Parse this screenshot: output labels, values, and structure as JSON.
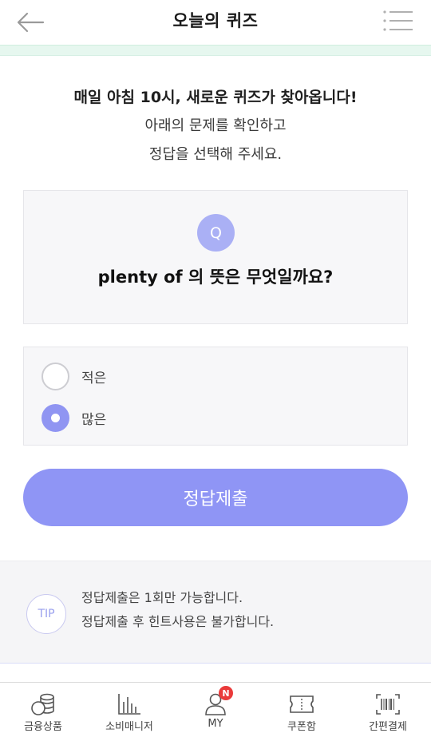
{
  "header": {
    "title": "오늘의 퀴즈",
    "back_icon": "arrow-left-icon",
    "menu_icon": "hamburger-menu-icon"
  },
  "intro": {
    "headline": "매일 아침 10시, 새로운 퀴즈가 찾아옵니다!",
    "line1": "아래의 문제를 확인하고",
    "line2": "정답을 선택해 주세요."
  },
  "question": {
    "badge": "Q",
    "text": "plenty of 의 뜻은 무엇일까요?"
  },
  "options": [
    {
      "label": "적은",
      "selected": false
    },
    {
      "label": "많은",
      "selected": true
    }
  ],
  "submit": {
    "label": "정답제출"
  },
  "tip": {
    "badge": "TIP",
    "line1": "정답제출은 1회만 가능합니다.",
    "line2": "정답제출 후 힌트사용은 불가합니다."
  },
  "bottom_nav": [
    {
      "label": "금융상품",
      "icon": "coins-icon"
    },
    {
      "label": "소비매니저",
      "icon": "bar-chart-icon"
    },
    {
      "label": "MY",
      "icon": "user-icon",
      "badge": "N"
    },
    {
      "label": "쿠폰함",
      "icon": "ticket-icon"
    },
    {
      "label": "간편결제",
      "icon": "barcode-icon"
    }
  ],
  "colors": {
    "accent": "#8f95f5",
    "mint_strip": "#e6f7ef",
    "badge_red": "#ea3a3a"
  }
}
